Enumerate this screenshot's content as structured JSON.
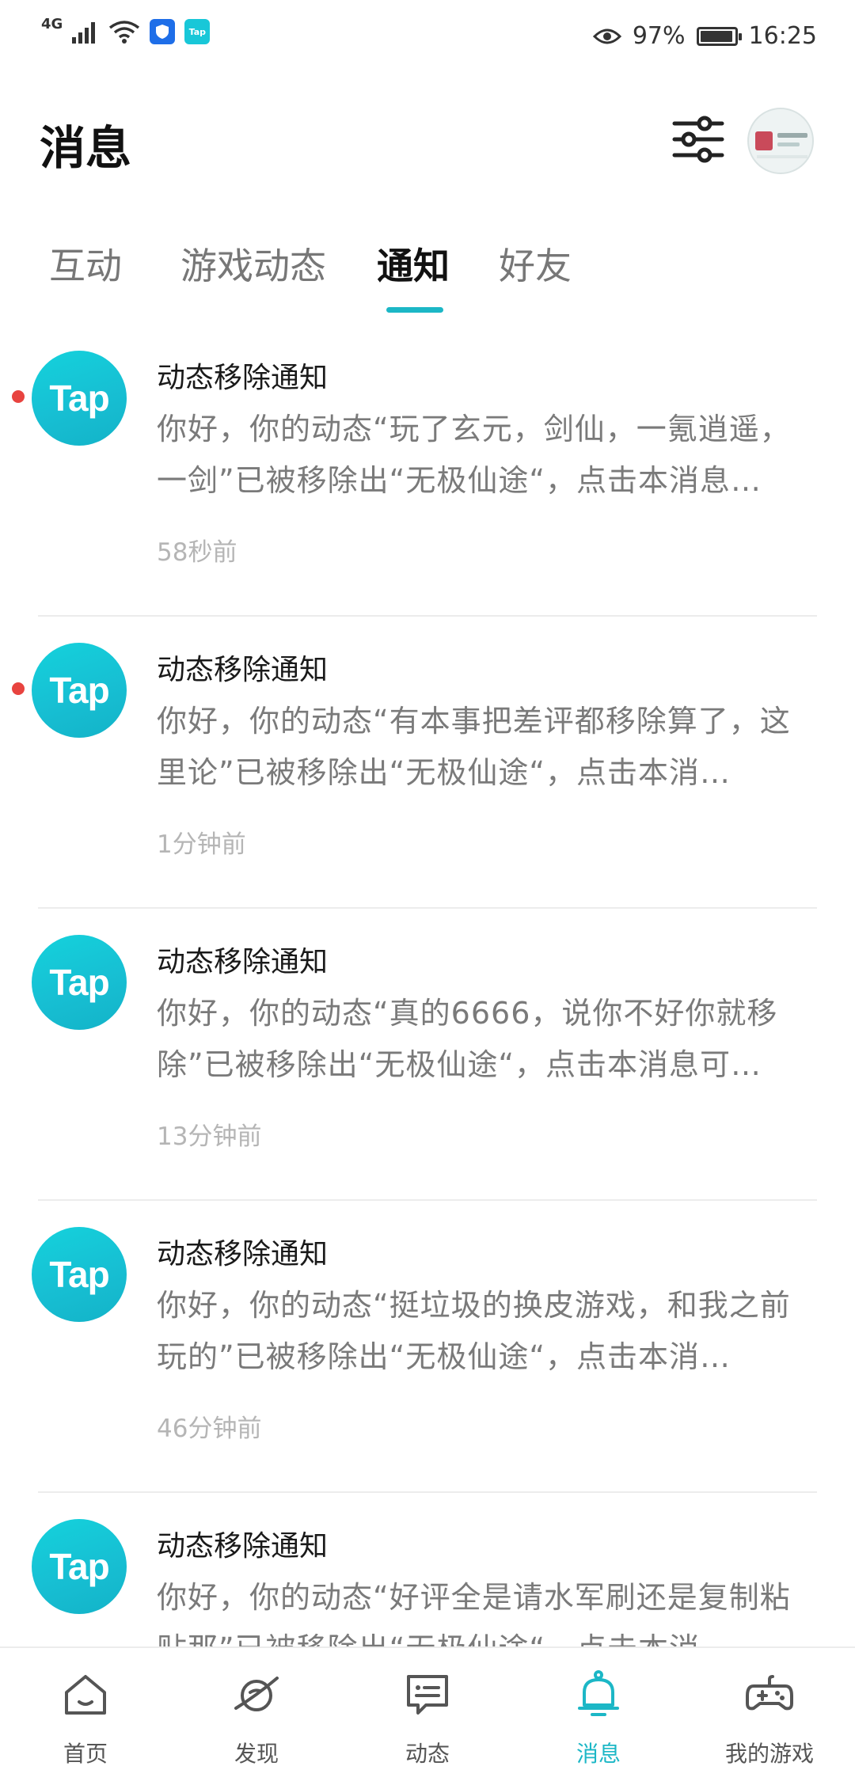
{
  "status_bar": {
    "network": "4G",
    "shield_app": "VPN",
    "tap_app": "Tap",
    "battery": "97%",
    "battery_level": 0.97,
    "time": "16:25"
  },
  "header": {
    "title": "消息"
  },
  "tabs": [
    {
      "label": "互动",
      "active": false
    },
    {
      "label": "游戏动态",
      "active": false
    },
    {
      "label": "通知",
      "active": true
    },
    {
      "label": "好友",
      "active": false
    }
  ],
  "notifications": [
    {
      "logo": "Tap",
      "title": "动态移除通知",
      "body": "你好，你的动态“玩了玄元，剑仙，一氪逍遥，一剑”已被移除出“无极仙途“，点击本消息…",
      "time": "58秒前",
      "unread": true
    },
    {
      "logo": "Tap",
      "title": "动态移除通知",
      "body": "你好，你的动态“有本事把差评都移除算了，这里论”已被移除出“无极仙途“，点击本消…",
      "time": "1分钟前",
      "unread": true
    },
    {
      "logo": "Tap",
      "title": "动态移除通知",
      "body": "你好，你的动态“真的6666，说你不好你就移除”已被移除出“无极仙途“，点击本消息可…",
      "time": "13分钟前",
      "unread": false
    },
    {
      "logo": "Tap",
      "title": "动态移除通知",
      "body": "你好，你的动态“挺垃圾的换皮游戏，和我之前玩的”已被移除出“无极仙途“，点击本消…",
      "time": "46分钟前",
      "unread": false
    },
    {
      "logo": "Tap",
      "title": "动态移除通知",
      "body": "你好，你的动态“好评全是请水军刷还是复制粘贴那”已被移除出“无极仙途“，点击本消…",
      "time": "",
      "unread": false
    }
  ],
  "bottom_nav": [
    {
      "label": "首页",
      "icon": "home-icon",
      "active": false
    },
    {
      "label": "发现",
      "icon": "planet-icon",
      "active": false
    },
    {
      "label": "动态",
      "icon": "chat-card-icon",
      "active": false
    },
    {
      "label": "消息",
      "icon": "bell-icon",
      "active": true
    },
    {
      "label": "我的游戏",
      "icon": "gamepad-icon",
      "active": false
    }
  ],
  "colors": {
    "accent": "#1cb7c6",
    "unread_dot": "#e8433f",
    "tap_logo": "#17c3d6"
  }
}
